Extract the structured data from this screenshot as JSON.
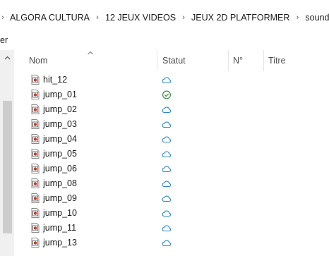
{
  "breadcrumb": {
    "items": [
      "ALGORA CULTURA",
      "12 JEUX VIDEOS",
      "JEUX 2D PLATFORMER",
      "sounds"
    ],
    "separator": "›"
  },
  "ribbon": {
    "cut_label": "er"
  },
  "columns": {
    "name": "Nom",
    "status": "Statut",
    "number": "N°",
    "title": "Titre"
  },
  "files": [
    {
      "name": "hit_12",
      "status": "cloud-icon"
    },
    {
      "name": "jump_01",
      "status": "synced-check-icon"
    },
    {
      "name": "jump_02",
      "status": "cloud-icon"
    },
    {
      "name": "jump_03",
      "status": "cloud-icon"
    },
    {
      "name": "jump_04",
      "status": "cloud-icon"
    },
    {
      "name": "jump_05",
      "status": "cloud-icon"
    },
    {
      "name": "jump_06",
      "status": "cloud-icon"
    },
    {
      "name": "jump_08",
      "status": "cloud-icon"
    },
    {
      "name": "jump_09",
      "status": "cloud-icon"
    },
    {
      "name": "jump_10",
      "status": "cloud-icon"
    },
    {
      "name": "jump_11",
      "status": "cloud-icon"
    },
    {
      "name": "jump_13",
      "status": "cloud-icon"
    }
  ],
  "colors": {
    "cloud": "#2b88d8",
    "synced": "#2e8b3a",
    "file_icon_red": "#c0392b"
  }
}
